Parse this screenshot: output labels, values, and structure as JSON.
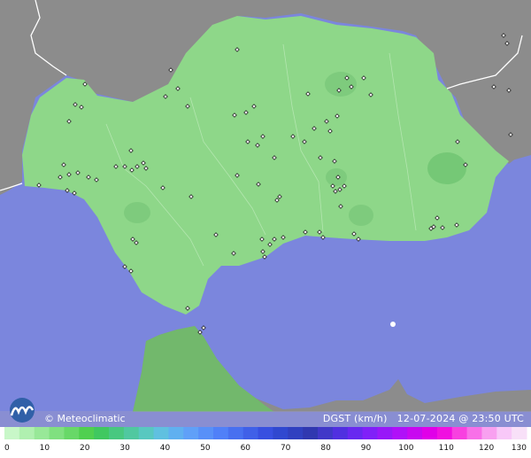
{
  "credit": "© Meteoclimatic",
  "variable": "DGST (km/h)",
  "timestamp": "12-07-2024 @ 23:50 UTC",
  "legend_ticks": [
    "0",
    "10",
    "20",
    "30",
    "40",
    "50",
    "60",
    "70",
    "80",
    "90",
    "100",
    "110",
    "120",
    "130"
  ],
  "legend_colors": [
    "#c8f7c8",
    "#b0f0b0",
    "#98e898",
    "#80e080",
    "#68d868",
    "#50d050",
    "#40c860",
    "#48c880",
    "#50c8a0",
    "#58c8c0",
    "#60c0e0",
    "#60b0f0",
    "#60a0f8",
    "#5890f8",
    "#5080f8",
    "#4870f0",
    "#4060e8",
    "#3850e0",
    "#3048d0",
    "#3040c0",
    "#3038b0",
    "#4038c8",
    "#5030e0",
    "#6828f0",
    "#8020f8",
    "#9818f8",
    "#b010f8",
    "#c808f0",
    "#e000e8",
    "#f010e0",
    "#f840e0",
    "#f870e8",
    "#f8a0f0",
    "#f8c8f8",
    "#f8e0f8"
  ],
  "colors": {
    "sea": "#7b86dd",
    "land_outside": "#8f8f8f",
    "andalucia": "#8fd88a",
    "morocco": "#6fb56a",
    "footer": "#9a9ac8"
  }
}
